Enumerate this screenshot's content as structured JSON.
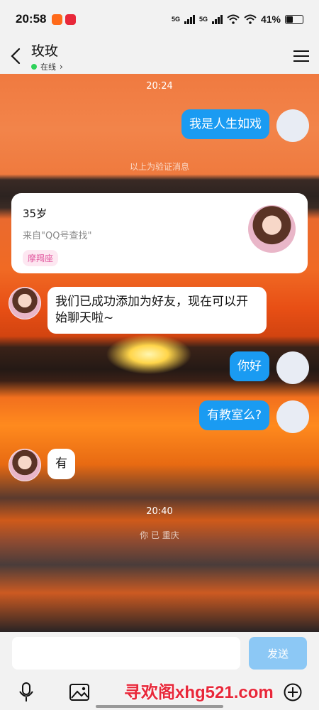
{
  "status_bar": {
    "time": "20:58",
    "network_1": "5G",
    "network_2": "5G",
    "battery": "41%",
    "battery_level": 0.41
  },
  "header": {
    "title": "玫玫",
    "presence": "在线"
  },
  "chat": {
    "timestamp_1": "20:24",
    "msg_me_1": "我是人生如戏",
    "verify_note": "以上为验证消息",
    "card": {
      "age": "35岁",
      "source": "来自\"QQ号查找\"",
      "tag": "摩羯座"
    },
    "msg_them_1": "我们已成功添加为好友，现在可以开始聊天啦~",
    "msg_me_2": "你好",
    "msg_me_3": "有教室么?",
    "msg_them_2": "有",
    "timestamp_2": "20:40",
    "sys_note": "你 已 重庆"
  },
  "input": {
    "placeholder": "",
    "send_label": "发送"
  },
  "toolbar": {
    "icons": [
      "mic-icon",
      "image-icon",
      "plus-circle-icon"
    ]
  },
  "watermark": "寻欢阁xhg521.com",
  "colors": {
    "my_bubble": "#1a9bf2",
    "send_button": "#8cc8f5",
    "online_dot": "#2fd25a",
    "tag_text": "#e25aa0"
  }
}
